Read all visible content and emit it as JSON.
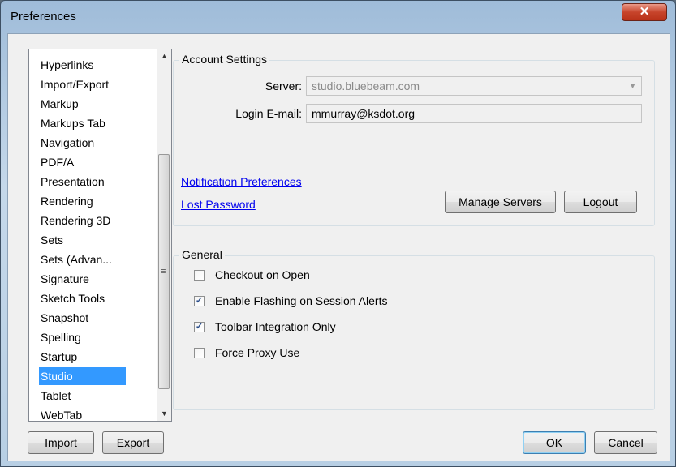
{
  "window": {
    "title": "Preferences",
    "close_glyph": "✕"
  },
  "sidebar": {
    "items": [
      {
        "label": "Hyperlinks"
      },
      {
        "label": "Import/Export"
      },
      {
        "label": "Markup"
      },
      {
        "label": "Markups Tab"
      },
      {
        "label": "Navigation"
      },
      {
        "label": "PDF/A"
      },
      {
        "label": "Presentation"
      },
      {
        "label": "Rendering"
      },
      {
        "label": "Rendering 3D"
      },
      {
        "label": "Sets"
      },
      {
        "label": "Sets (Advan..."
      },
      {
        "label": "Signature"
      },
      {
        "label": "Sketch Tools"
      },
      {
        "label": "Snapshot"
      },
      {
        "label": "Spelling"
      },
      {
        "label": "Startup"
      },
      {
        "label": "Studio",
        "selected": true
      },
      {
        "label": "Tablet"
      },
      {
        "label": "WebTab"
      }
    ],
    "scroll_up_glyph": "▲",
    "scroll_down_glyph": "▼",
    "grip_glyph": "≡"
  },
  "account": {
    "group_label": "Account Settings",
    "server_label": "Server:",
    "server_value": "studio.bluebeam.com",
    "dropdown_glyph": "▼",
    "email_label": "Login E-mail:",
    "email_value": "mmurray@ksdot.org",
    "notification_link": "Notification Preferences",
    "lost_password_link": "Lost Password",
    "manage_servers_label": "Manage Servers",
    "logout_label": "Logout"
  },
  "general": {
    "group_label": "General",
    "check_glyph": "✓",
    "options": [
      {
        "label": "Checkout on Open",
        "checked": false
      },
      {
        "label": "Enable Flashing on Session Alerts",
        "checked": true
      },
      {
        "label": "Toolbar Integration Only",
        "checked": true
      },
      {
        "label": "Force Proxy Use",
        "checked": false
      }
    ]
  },
  "footer": {
    "import_label": "Import",
    "export_label": "Export",
    "ok_label": "OK",
    "cancel_label": "Cancel"
  },
  "colors": {
    "selection": "#3399ff",
    "link": "#0000ee",
    "close_button": "#c7442b"
  }
}
